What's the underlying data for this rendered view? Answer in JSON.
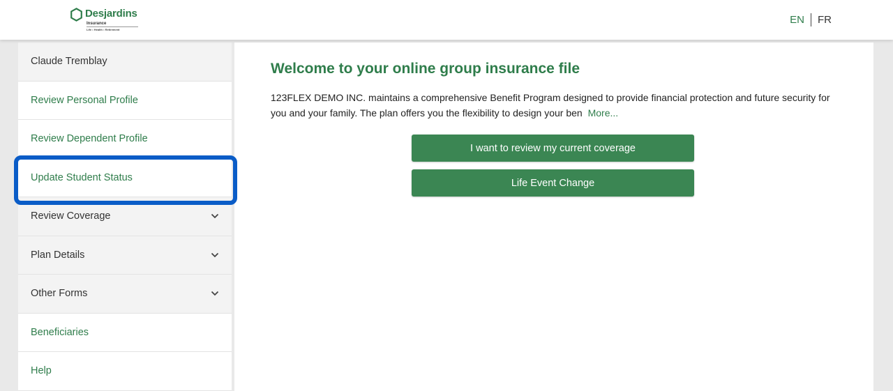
{
  "header": {
    "logo": {
      "name": "Desjardins",
      "line1": "Insurance",
      "line2": "Life • Health • Retirement"
    },
    "lang": {
      "en": "EN",
      "fr": "FR"
    }
  },
  "sidebar": {
    "user_name": "Claude Tremblay",
    "items": [
      {
        "label": "Review Personal Profile"
      },
      {
        "label": "Review Dependent Profile"
      },
      {
        "label": "Update Student Status"
      },
      {
        "label": "Review Coverage"
      },
      {
        "label": "Plan Details"
      },
      {
        "label": "Other Forms"
      },
      {
        "label": "Beneficiaries"
      },
      {
        "label": "Help"
      }
    ]
  },
  "main": {
    "title": "Welcome to your online group insurance file",
    "intro": "123FLEX DEMO INC. maintains a comprehensive Benefit Program designed to provide financial protection and future security for you and your family. The plan offers you the flexibility to design your ben",
    "more": "More...",
    "btn_review": "I want to review my current coverage",
    "btn_life_event": "Life Event Change"
  },
  "colors": {
    "brand_green": "#2f7d4b",
    "button_green": "#3b8653",
    "highlight_blue": "#0a5cc7"
  }
}
